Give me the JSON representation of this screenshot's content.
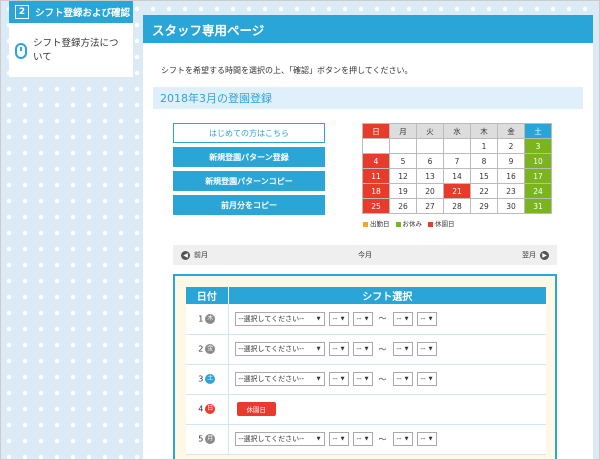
{
  "sidebar": {
    "active": {
      "num": "2",
      "label": "シフト登録および確認"
    },
    "items": [
      {
        "label": "シフト登録方法について"
      }
    ]
  },
  "page": {
    "title": "スタッフ専用ページ",
    "intro": "シフトを希望する時間を選択の上、「確認」ボタンを押してください。",
    "section_title": "2018年3月の登園登録"
  },
  "buttons": {
    "first_time": "はじめての方はこちら",
    "new_pattern": "新規登園パターン登録",
    "copy_pattern": "新規登園パターンコピー",
    "copy_prev": "前月分をコピー"
  },
  "calendar": {
    "headers": [
      "日",
      "月",
      "火",
      "水",
      "木",
      "金",
      "土"
    ],
    "weeks": [
      [
        "",
        "",
        "",
        "",
        "1",
        "2",
        "3"
      ],
      [
        "4",
        "5",
        "6",
        "7",
        "8",
        "9",
        "10"
      ],
      [
        "11",
        "12",
        "13",
        "14",
        "15",
        "16",
        "17"
      ],
      [
        "18",
        "19",
        "20",
        "21",
        "22",
        "23",
        "24"
      ],
      [
        "25",
        "26",
        "27",
        "28",
        "29",
        "30",
        "31"
      ]
    ],
    "colors": {
      "sunday": "#e83b2c",
      "saturday": "#7ab51d",
      "holiday": "#e83b2c",
      "accent": "#2aa5d8"
    }
  },
  "legend": {
    "attend": "出勤日",
    "off": "お休み",
    "closed": "休園日",
    "attend_color": "#f5a623",
    "off_color": "#7ab51d",
    "closed_color": "#e83b2c"
  },
  "month_nav": {
    "prev": "前月",
    "current": "今月",
    "next": "翌月"
  },
  "shift": {
    "col_date": "日付",
    "col_select": "シフト選択",
    "placeholder": "--選択してください--",
    "time_placeholder": "--",
    "tilde": "〜",
    "holiday_label": "休園日",
    "rows": [
      {
        "day": "1",
        "dow": "木",
        "dow_color": "#888888",
        "holiday": false
      },
      {
        "day": "2",
        "dow": "金",
        "dow_color": "#888888",
        "holiday": false
      },
      {
        "day": "3",
        "dow": "土",
        "dow_color": "#2aa5d8",
        "holiday": false
      },
      {
        "day": "4",
        "dow": "日",
        "dow_color": "#e83b2c",
        "holiday": true
      },
      {
        "day": "5",
        "dow": "月",
        "dow_color": "#888888",
        "holiday": false
      }
    ]
  }
}
